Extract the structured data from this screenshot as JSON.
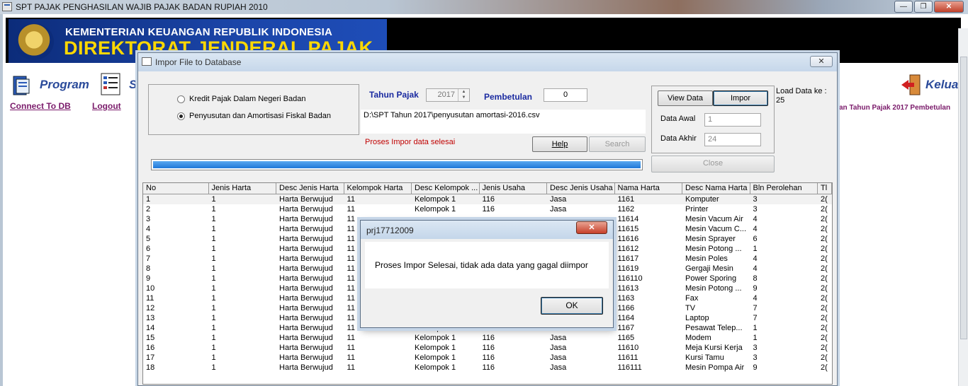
{
  "app": {
    "title": "SPT PAJAK PENGHASILAN WAJIB PAJAK BADAN RUPIAH 2010",
    "min_glyph": "—",
    "max_glyph": "❐",
    "close_glyph": "✕"
  },
  "banner": {
    "ministry": "KEMENTERIAN KEUANGAN REPUBLIK INDONESIA",
    "directorate": "DIREKTORAT JENDERAL PAJAK"
  },
  "menu": {
    "program_label": "Program",
    "setup_label": "S",
    "exit_label": "Kelua",
    "connect_link": "Connect To DB",
    "logout_link": "Logout",
    "status_text": "an Tahun Pajak 2017 Pembetulan"
  },
  "dialog": {
    "title": "Impor File to Database",
    "close_glyph": "✕",
    "radio_kredit": "Kredit Pajak Dalam Negeri Badan",
    "radio_penyusutan": "Penyusutan dan Amortisasi Fiskal Badan",
    "tahun_pajak_label": "Tahun Pajak",
    "tahun_pajak_value": "2017",
    "pembetulan_label": "Pembetulan",
    "pembetulan_value": "0",
    "file_path": "D:\\SPT Tahun 2017\\penyusutan amortasi-2016.csv",
    "status_message": "Proses Impor data selesai",
    "help_button": "Help",
    "search_button": "Search",
    "view_data_button": "View Data",
    "impor_button": "Impor",
    "data_awal_label": "Data Awal",
    "data_awal_value": "1",
    "data_akhir_label": "Data Akhir",
    "data_akhir_value": "24",
    "close_button": "Close",
    "load_label": "Load Data ke :",
    "load_value": "25",
    "progress": 1.0,
    "status_color": "#c00000"
  },
  "grid": {
    "columns": [
      "No",
      "Jenis Harta",
      "Desc Jenis Harta",
      "Kelompok Harta",
      "Desc Kelompok ...",
      "Jenis Usaha",
      "Desc Jenis Usaha",
      "Nama Harta",
      "Desc Nama Harta",
      "Bln Perolehan",
      "Tl"
    ],
    "rows": [
      [
        "1",
        "1",
        "Harta Berwujud",
        "11",
        "Kelompok 1",
        "116",
        "Jasa",
        "1161",
        "Komputer",
        "3",
        "2("
      ],
      [
        "2",
        "1",
        "Harta Berwujud",
        "11",
        "Kelompok 1",
        "116",
        "Jasa",
        "1162",
        "Printer",
        "3",
        "2("
      ],
      [
        "3",
        "1",
        "Harta Berwujud",
        "11",
        "",
        "",
        "",
        "11614",
        "Mesin Vacum Air",
        "4",
        "2("
      ],
      [
        "4",
        "1",
        "Harta Berwujud",
        "11",
        "",
        "",
        "",
        "11615",
        "Mesin Vacum C...",
        "4",
        "2("
      ],
      [
        "5",
        "1",
        "Harta Berwujud",
        "11",
        "",
        "",
        "",
        "11616",
        "Mesin Sprayer",
        "6",
        "2("
      ],
      [
        "6",
        "1",
        "Harta Berwujud",
        "11",
        "",
        "",
        "",
        "11612",
        "Mesin Potong ...",
        "1",
        "2("
      ],
      [
        "7",
        "1",
        "Harta Berwujud",
        "11",
        "",
        "",
        "",
        "11617",
        "Mesin Poles",
        "4",
        "2("
      ],
      [
        "8",
        "1",
        "Harta Berwujud",
        "11",
        "",
        "",
        "",
        "11619",
        "Gergaji Mesin",
        "4",
        "2("
      ],
      [
        "9",
        "1",
        "Harta Berwujud",
        "11",
        "",
        "",
        "",
        "116110",
        "Power Sporing",
        "8",
        "2("
      ],
      [
        "10",
        "1",
        "Harta Berwujud",
        "11",
        "",
        "",
        "",
        "11613",
        "Mesin Potong ...",
        "9",
        "2("
      ],
      [
        "11",
        "1",
        "Harta Berwujud",
        "11",
        "",
        "",
        "",
        "1163",
        "Fax",
        "4",
        "2("
      ],
      [
        "12",
        "1",
        "Harta Berwujud",
        "11",
        "",
        "",
        "",
        "1166",
        "TV",
        "7",
        "2("
      ],
      [
        "13",
        "1",
        "Harta Berwujud",
        "11",
        "",
        "",
        "",
        "1164",
        "Laptop",
        "7",
        "2("
      ],
      [
        "14",
        "1",
        "Harta Berwujud",
        "11",
        "Kelompok 1",
        "116",
        "Jasa",
        "1167",
        "Pesawat Telep...",
        "1",
        "2("
      ],
      [
        "15",
        "1",
        "Harta Berwujud",
        "11",
        "Kelompok 1",
        "116",
        "Jasa",
        "1165",
        "Modem",
        "1",
        "2("
      ],
      [
        "16",
        "1",
        "Harta Berwujud",
        "11",
        "Kelompok 1",
        "116",
        "Jasa",
        "11610",
        "Meja Kursi Kerja",
        "3",
        "2("
      ],
      [
        "17",
        "1",
        "Harta Berwujud",
        "11",
        "Kelompok 1",
        "116",
        "Jasa",
        "11611",
        "Kursi Tamu",
        "3",
        "2("
      ],
      [
        "18",
        "1",
        "Harta Berwujud",
        "11",
        "Kelompok 1",
        "116",
        "Jasa",
        "116111",
        "Mesin Pompa Air",
        "9",
        "2("
      ]
    ]
  },
  "msgbox": {
    "title": "prj17712009",
    "close_glyph": "✕",
    "message": "Proses Impor Selesai, tidak ada data yang gagal diimpor",
    "ok_button": "OK"
  }
}
